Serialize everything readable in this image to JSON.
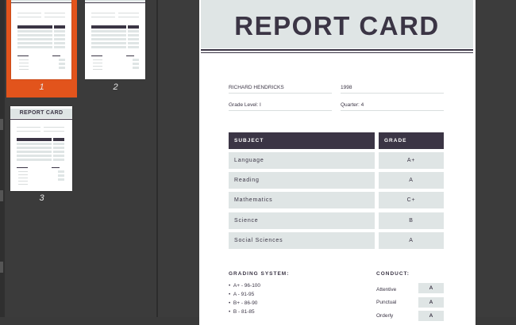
{
  "document": {
    "title": "REPORT CARD",
    "student_name": "RICHARD HENDRICKS",
    "year": "1998",
    "grade_level": "Grade Level: I",
    "quarter": "Quarter: 4",
    "table": {
      "headers": [
        "SUBJECT",
        "GRADE"
      ],
      "rows": [
        {
          "subject": "Language",
          "grade": "A+"
        },
        {
          "subject": "Reading",
          "grade": "A"
        },
        {
          "subject": "Mathematics",
          "grade": "C+"
        },
        {
          "subject": "Science",
          "grade": "B"
        },
        {
          "subject": "Social Sciences",
          "grade": "A"
        }
      ]
    },
    "grading_system": {
      "label": "GRADING SYSTEM:",
      "items": [
        "A+ - 96-100",
        "A - 91-95",
        "B+ - 86-90",
        "B - 81-85"
      ]
    },
    "conduct": {
      "label": "CONDUCT:",
      "items": [
        {
          "label": "Attentive",
          "value": "A"
        },
        {
          "label": "Punctual",
          "value": "A"
        },
        {
          "label": "Orderly",
          "value": "A"
        }
      ]
    }
  },
  "thumbnails": [
    {
      "number": "1",
      "selected": true
    },
    {
      "number": "2",
      "selected": false
    },
    {
      "number": "3",
      "selected": false
    }
  ],
  "colors": {
    "accent": "#e2541c",
    "header_dark": "#3b3545",
    "cell_light": "#dfe5e5",
    "app_background": "#3c3c3c"
  }
}
